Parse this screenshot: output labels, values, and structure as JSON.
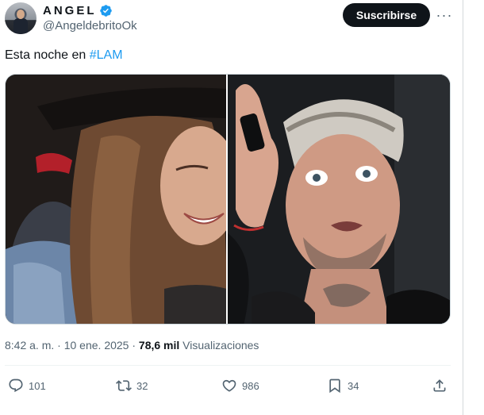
{
  "author": {
    "name": "ANGEL",
    "handle": "@AngeldebritoOk"
  },
  "header": {
    "subscribe_label": "Suscribirse",
    "more_label": "···"
  },
  "tweet": {
    "text_prefix": "Esta noche en ",
    "hashtag": "#LAM"
  },
  "meta": {
    "time": "8:42 a. m.",
    "separator1": " · ",
    "date": "10 ene. 2025",
    "separator2": " · ",
    "views_count": "78,6 mil",
    "views_label": " Visualizaciones"
  },
  "actions": {
    "replies": "101",
    "reposts": "32",
    "likes": "986",
    "bookmarks": "34"
  },
  "colors": {
    "accent": "#1d9bf0",
    "text": "#0f1419",
    "muted": "#536471",
    "button": "#0f1419"
  }
}
